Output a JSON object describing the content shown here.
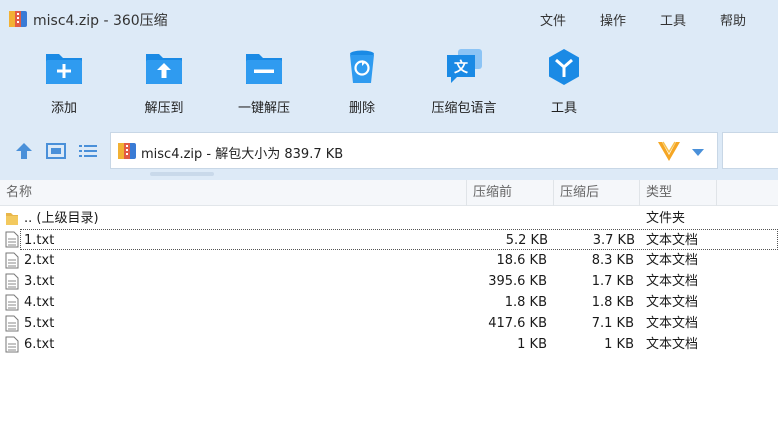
{
  "window": {
    "title": "misc4.zip - 360压缩"
  },
  "menu": {
    "file": "文件",
    "operate": "操作",
    "tools": "工具",
    "help": "帮助"
  },
  "toolbar": {
    "add": "添加",
    "extract_to": "解压到",
    "one_click_extract": "一键解压",
    "delete": "删除",
    "language": "压缩包语言",
    "tools": "工具"
  },
  "address": {
    "text": "misc4.zip - 解包大小为 839.7 KB"
  },
  "columns": {
    "name": "名称",
    "before": "压缩前",
    "after": "压缩后",
    "type": "类型"
  },
  "files": [
    {
      "name": ".. (上级目录)",
      "before": "",
      "after": "",
      "type": "文件夹"
    },
    {
      "name": "1.txt",
      "before": "5.2 KB",
      "after": "3.7 KB",
      "type": "文本文档"
    },
    {
      "name": "2.txt",
      "before": "18.6 KB",
      "after": "8.3 KB",
      "type": "文本文档"
    },
    {
      "name": "3.txt",
      "before": "395.6 KB",
      "after": "1.7 KB",
      "type": "文本文档"
    },
    {
      "name": "4.txt",
      "before": "1.8 KB",
      "after": "1.8 KB",
      "type": "文本文档"
    },
    {
      "name": "5.txt",
      "before": "417.6 KB",
      "after": "7.1 KB",
      "type": "文本文档"
    },
    {
      "name": "6.txt",
      "before": "1 KB",
      "after": "1 KB",
      "type": "文本文档"
    }
  ],
  "colors": {
    "accent": "#1a8ae5",
    "band": "#ddeaf7",
    "v_logo": "#f5a623"
  }
}
